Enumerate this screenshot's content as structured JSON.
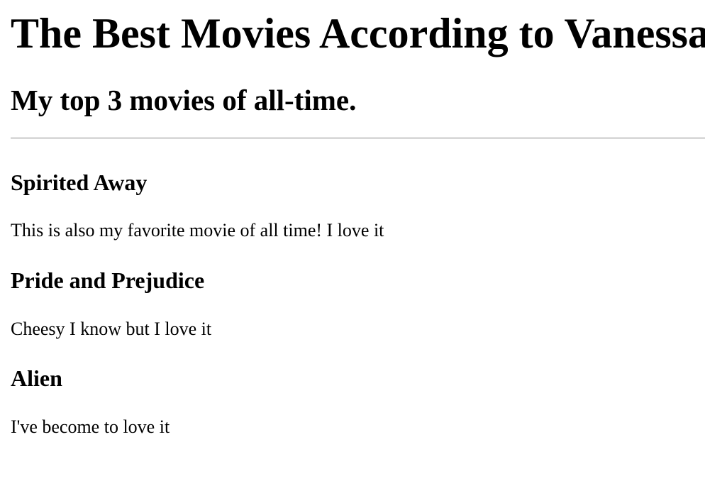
{
  "header": {
    "title": "The Best Movies According to Vanessa",
    "subtitle": "My top 3 movies of all-time."
  },
  "movies": [
    {
      "title": "Spirited Away",
      "description": "This is also my favorite movie of all time! I love it"
    },
    {
      "title": "Pride and Prejudice",
      "description": "Cheesy I know but I love it"
    },
    {
      "title": "Alien",
      "description": "I've become to love it"
    }
  ]
}
